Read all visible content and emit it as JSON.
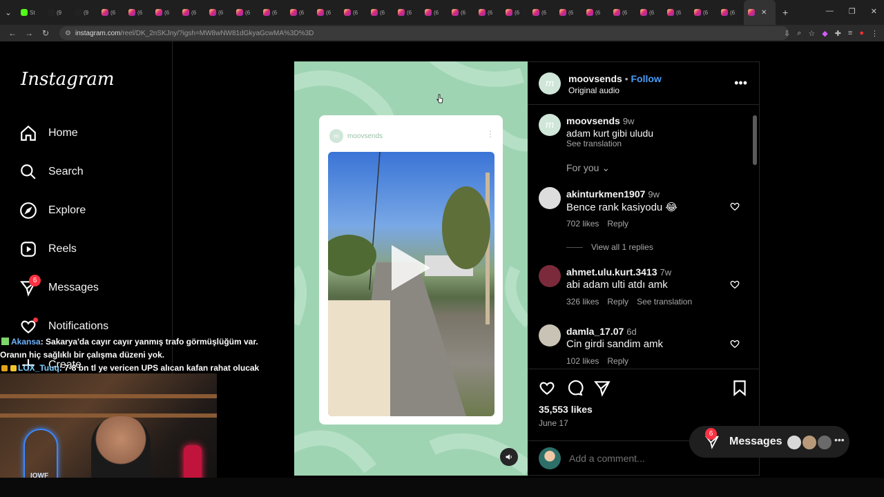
{
  "browser": {
    "tabs": [
      {
        "label": "St",
        "icon": "kick-icon"
      },
      {
        "label": "(9",
        "icon": "tiktok-icon"
      },
      {
        "label": "(9",
        "icon": "tiktok-icon"
      },
      {
        "label": "(6",
        "icon": "instagram-icon"
      },
      {
        "label": "(6",
        "icon": "instagram-icon"
      },
      {
        "label": "(6",
        "icon": "instagram-icon"
      },
      {
        "label": "(6",
        "icon": "instagram-icon"
      },
      {
        "label": "(6",
        "icon": "instagram-icon"
      },
      {
        "label": "(6",
        "icon": "instagram-icon"
      },
      {
        "label": "(6",
        "icon": "instagram-icon"
      },
      {
        "label": "(6",
        "icon": "instagram-icon"
      },
      {
        "label": "(6",
        "icon": "instagram-icon"
      },
      {
        "label": "(6",
        "icon": "instagram-icon"
      },
      {
        "label": "(6",
        "icon": "instagram-icon"
      },
      {
        "label": "(6",
        "icon": "instagram-icon"
      },
      {
        "label": "(6",
        "icon": "instagram-icon"
      },
      {
        "label": "(6",
        "icon": "instagram-icon"
      },
      {
        "label": "(6",
        "icon": "instagram-icon"
      },
      {
        "label": "(6",
        "icon": "instagram-icon"
      },
      {
        "label": "(6",
        "icon": "instagram-icon"
      },
      {
        "label": "(6",
        "icon": "instagram-icon"
      },
      {
        "label": "(6",
        "icon": "instagram-icon"
      },
      {
        "label": "(6",
        "icon": "instagram-icon"
      },
      {
        "label": "(6",
        "icon": "instagram-icon"
      },
      {
        "label": "(6",
        "icon": "instagram-icon"
      },
      {
        "label": "(6",
        "icon": "instagram-icon"
      },
      {
        "label": "(6",
        "icon": "instagram-icon"
      },
      {
        "label": "(6",
        "icon": "instagram-icon"
      }
    ],
    "url_host": "instagram.com",
    "url_path": "/reel/DK_2nSKJny/?igsh=MW8wNW81dGkyaGcwMA%3D%3D"
  },
  "sidebar": {
    "logo": "Instagram",
    "items": [
      {
        "label": "Home",
        "icon": "home-icon"
      },
      {
        "label": "Search",
        "icon": "search-icon"
      },
      {
        "label": "Explore",
        "icon": "compass-icon"
      },
      {
        "label": "Reels",
        "icon": "reels-icon"
      },
      {
        "label": "Messages",
        "icon": "messages-icon",
        "badge": "6"
      },
      {
        "label": "Notifications",
        "icon": "heart-icon"
      },
      {
        "label": "Create",
        "icon": "plus-icon"
      }
    ]
  },
  "reel": {
    "card_username": "moovsends"
  },
  "post": {
    "username": "moovsends",
    "separator": "•",
    "follow_label": "Follow",
    "audio": "Original audio",
    "caption": {
      "username": "moovsends",
      "time": "9w",
      "text": "adam kurt gibi uludu",
      "translate": "See translation"
    },
    "for_you": "For you",
    "comments": [
      {
        "username": "akinturkmen1907",
        "time": "9w",
        "text": "Bence rank kasiyodu 😂",
        "likes": "702 likes",
        "reply": "Reply",
        "view_replies": "View all 1 replies"
      },
      {
        "username": "ahmet.ulu.kurt.3413",
        "time": "7w",
        "text": "abi adam ulti atdı amk",
        "likes": "326 likes",
        "reply": "Reply",
        "translate": "See translation"
      },
      {
        "username": "damla_17.07",
        "time": "6d",
        "text": "Cin girdi sandim amk",
        "likes": "102 likes",
        "reply": "Reply"
      }
    ],
    "likes": "35,553 likes",
    "date": "June 17",
    "add_comment_placeholder": "Add a comment..."
  },
  "messages_pill": {
    "label": "Messages",
    "badge": "6"
  },
  "stream_chat": [
    {
      "name": "Akansa",
      "text": ": Sakarya'da cayır cayır yanmış trafo görmüşlüğüm var. Oranın hiç sağlıklı bir çalışma düzeni yok."
    },
    {
      "name": "LOX_Tuuq",
      "text": ": 7-8 bn tl ye vericen UPS alıcan kafan rahat olucak"
    }
  ],
  "webcam": {
    "neon_text": "IOWF"
  },
  "colors": {
    "accent": "#4a9df8",
    "badge": "#ff3040",
    "reel_bg": "#9fd4b3"
  }
}
